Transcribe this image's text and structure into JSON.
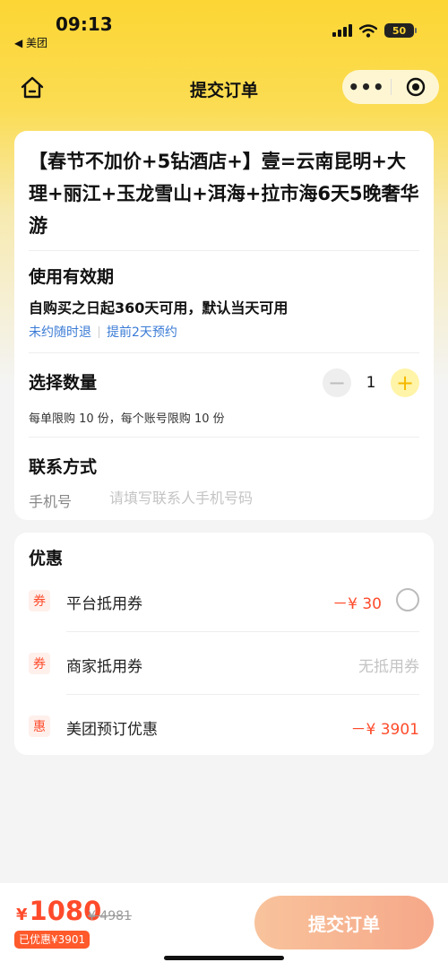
{
  "status_bar": {
    "time": "09:13",
    "back_app": "◀ 美团",
    "battery": "50"
  },
  "nav": {
    "title": "提交订单",
    "more_icon": "more-dots-icon",
    "close_icon": "target-circle-icon"
  },
  "product": {
    "title": "【春节不加价+5钻酒店+】壹=云南昆明+大理+丽江+玉龙雪山+洱海+拉市海6天5晚奢华游"
  },
  "validity": {
    "title": "使用有效期",
    "text": "自购买之日起360天可用，默认当天可用",
    "tags": [
      "未约随时退",
      "提前2天预约"
    ]
  },
  "quantity": {
    "title": "选择数量",
    "value": "1",
    "minus": "−",
    "plus": "+",
    "limit": "每单限购 10 份，每个账号限购 10 份"
  },
  "contact": {
    "title": "联系方式",
    "phone_label": "手机号",
    "phone_placeholder": "请填写联系人手机号码",
    "phone_value": ""
  },
  "discounts": {
    "title": "优惠",
    "rows": [
      {
        "badge": "券",
        "label": "平台抵用券",
        "amount": "－¥ 30"
      },
      {
        "badge": "券",
        "label": "商家抵用券",
        "status": "无抵用券"
      },
      {
        "badge": "惠",
        "label": "美团预订优惠",
        "amount": "－¥ 3901"
      }
    ]
  },
  "footer": {
    "currency": "¥",
    "price": "1080",
    "original": "¥ 4981",
    "saved": "已优惠¥3901",
    "submit": "提交订单"
  },
  "colors": {
    "brand_yellow": "#fcd634",
    "discount_red": "#ff4b2b",
    "link_blue": "#3a7bd5",
    "submit_orange": "#f6a889"
  }
}
